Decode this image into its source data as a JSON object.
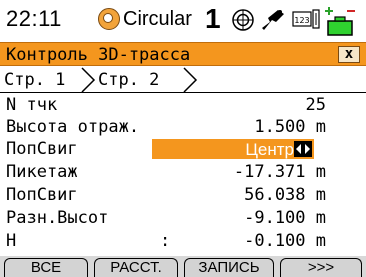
{
  "status": {
    "time": "22:11",
    "mode": "Circular",
    "face": "1",
    "icons": [
      "clock-icon",
      "prism-target-icon",
      "laser-icon",
      "counter-icon",
      "battery-icon"
    ],
    "counter_text": "123"
  },
  "window": {
    "title": "Контроль 3D-трасса",
    "close": "x"
  },
  "tabs": {
    "tab1": "Стр.  1",
    "tab2": "Стр.  2"
  },
  "rows": [
    {
      "label": "N тчк",
      "value": "25"
    },
    {
      "label": "Высота отраж.",
      "value": "1.500 m"
    },
    {
      "label": "ПопСвиг",
      "value": "Центр",
      "selectable": true
    },
    {
      "label": "Пикетаж",
      "value": "-17.371 m"
    },
    {
      "label": "ПопСвиг",
      "value": "56.038 m"
    },
    {
      "label": "Разн.Высот",
      "value": "-9.100 m"
    },
    {
      "label": "H",
      "colon": ":",
      "value": "-0.100 m"
    }
  ],
  "softkeys": [
    "ВСЕ",
    "РАССТ.",
    "ЗАПИСЬ",
    ">>>"
  ],
  "colors": {
    "accent": "#f4961e",
    "selected_text": "#ffffff"
  }
}
